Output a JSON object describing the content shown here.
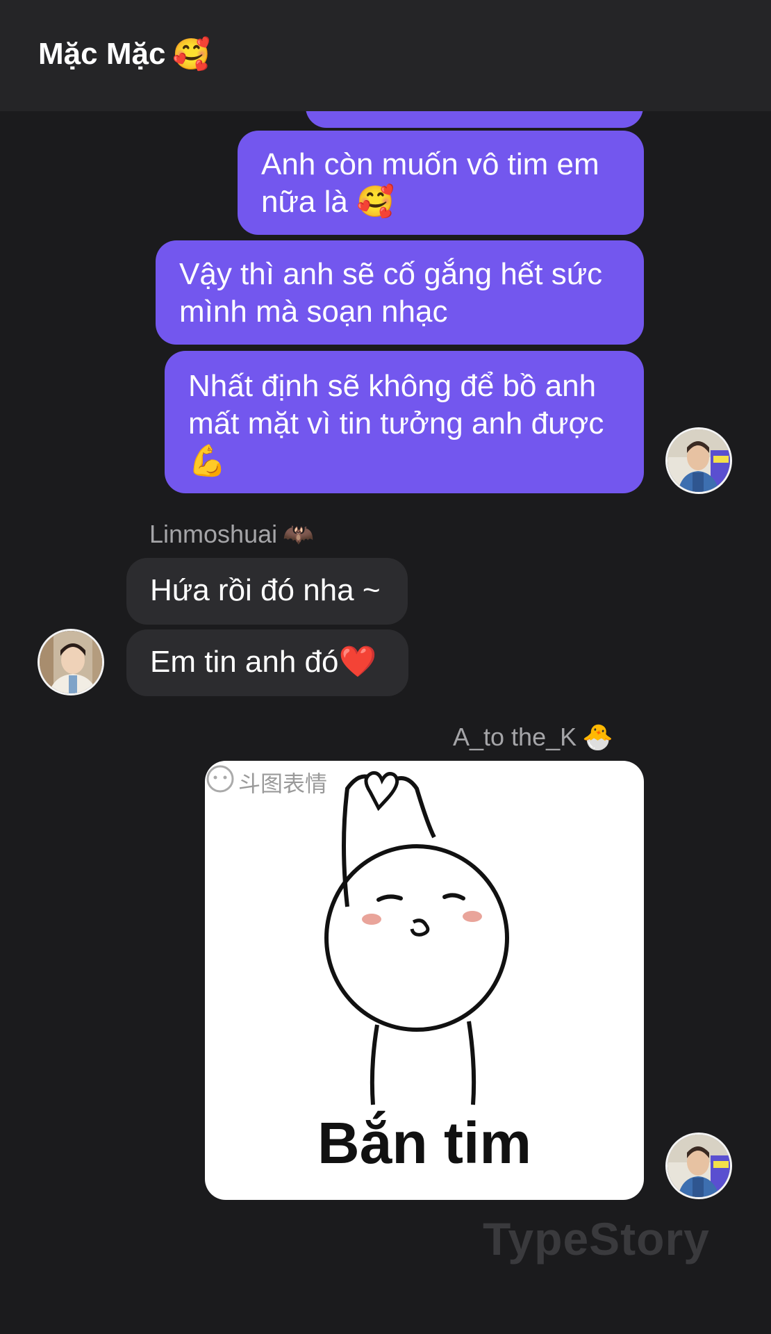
{
  "header": {
    "title": "Mặc Mặc",
    "title_emoji": "🥰"
  },
  "messages": {
    "out1_text": "Anh còn muốn vô tim em nữa là 🥰",
    "out2_text": "Vậy thì anh sẽ cố gắng hết sức mình mà soạn nhạc",
    "out3_text": "Nhất định sẽ không để bồ anh mất mặt vì tin tưởng anh được 💪",
    "in_sender": "Linmoshuai",
    "in_sender_emoji": "🦇",
    "in1_text": "Hứa rồi đó nha ~",
    "in2_text": "Em tin anh đó❤️",
    "sticker_sender": "A_to the_K",
    "sticker_sender_emoji": "🐣"
  },
  "sticker": {
    "watermark": "斗图表情",
    "caption": "Bắn tim"
  },
  "watermark": "TypeStory",
  "colors": {
    "background": "#1b1b1d",
    "header": "#252527",
    "outgoing_bubble": "#7357ee",
    "incoming_bubble": "#2c2c2f"
  }
}
